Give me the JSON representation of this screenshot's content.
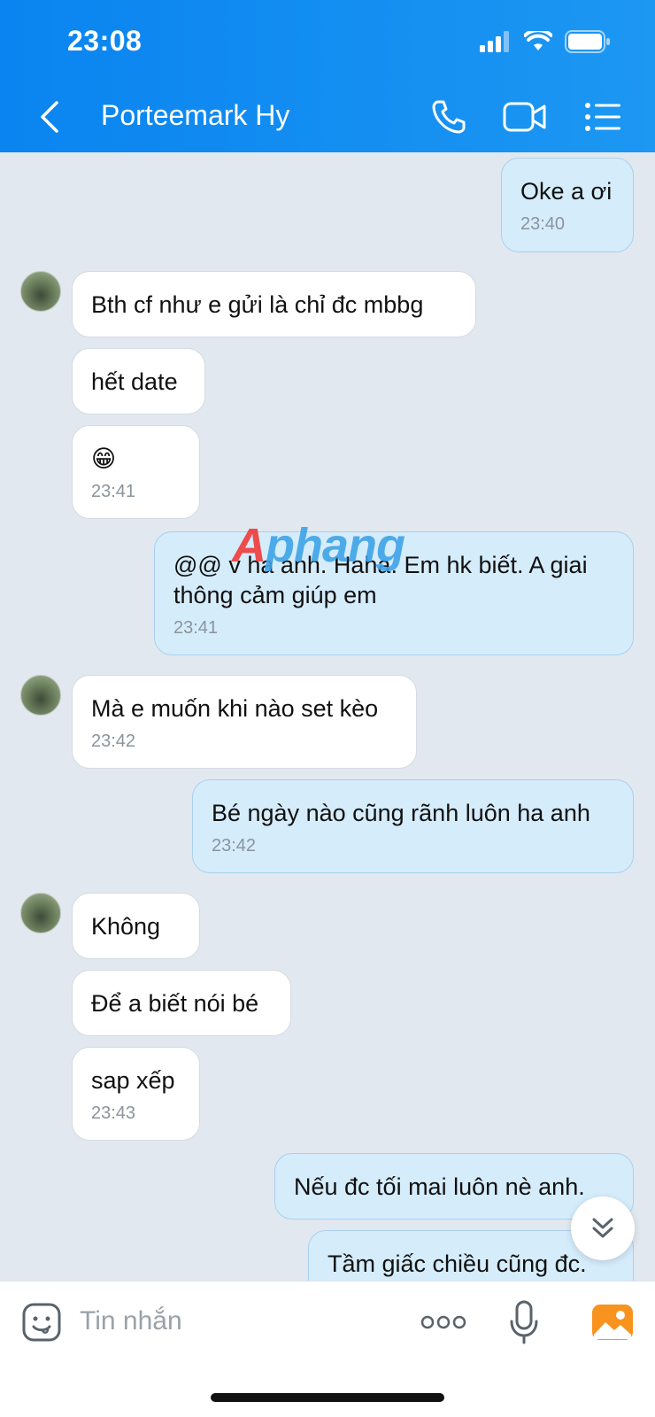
{
  "status_bar": {
    "time": "23:08"
  },
  "header": {
    "title": "Porteemark Hy"
  },
  "messages": [
    {
      "text": "Oke a ơi",
      "time": "23:40"
    },
    {
      "text": "Bth  cf như e gửi là chỉ đc mbbg"
    },
    {
      "text": "hết date"
    },
    {
      "text": "😁",
      "time": "23:41"
    },
    {
      "text": "@@ v ha anh. Haha. Em hk biết. A giai thông cảm giúp em",
      "time": "23:41"
    },
    {
      "text": "Mà e muốn khi nào set kèo",
      "time": "23:42"
    },
    {
      "text": "Bé ngày nào cũng rãnh luôn ha anh",
      "time": "23:42"
    },
    {
      "text": "Không"
    },
    {
      "text": "Để a biết nói bé"
    },
    {
      "text": "sap xếp",
      "time": "23:43"
    },
    {
      "text": "Nếu đc tối mai luôn nè anh."
    },
    {
      "text": "Tầm giấc chiều cũng đc."
    }
  ],
  "watermark": {
    "part1": "A",
    "part2": "phang"
  },
  "input": {
    "placeholder": "Tin nhắn"
  },
  "colors": {
    "header": "#0a84f0",
    "outgoing_bubble": "#d5ecfb",
    "incoming_bubble": "#ffffff",
    "chat_background": "#e2e8ef"
  },
  "icons": [
    "back-arrow-icon",
    "phone-icon",
    "video-call-icon",
    "menu-list-icon",
    "sticker-icon",
    "more-icon",
    "microphone-icon",
    "image-icon",
    "chevron-double-down-icon"
  ]
}
